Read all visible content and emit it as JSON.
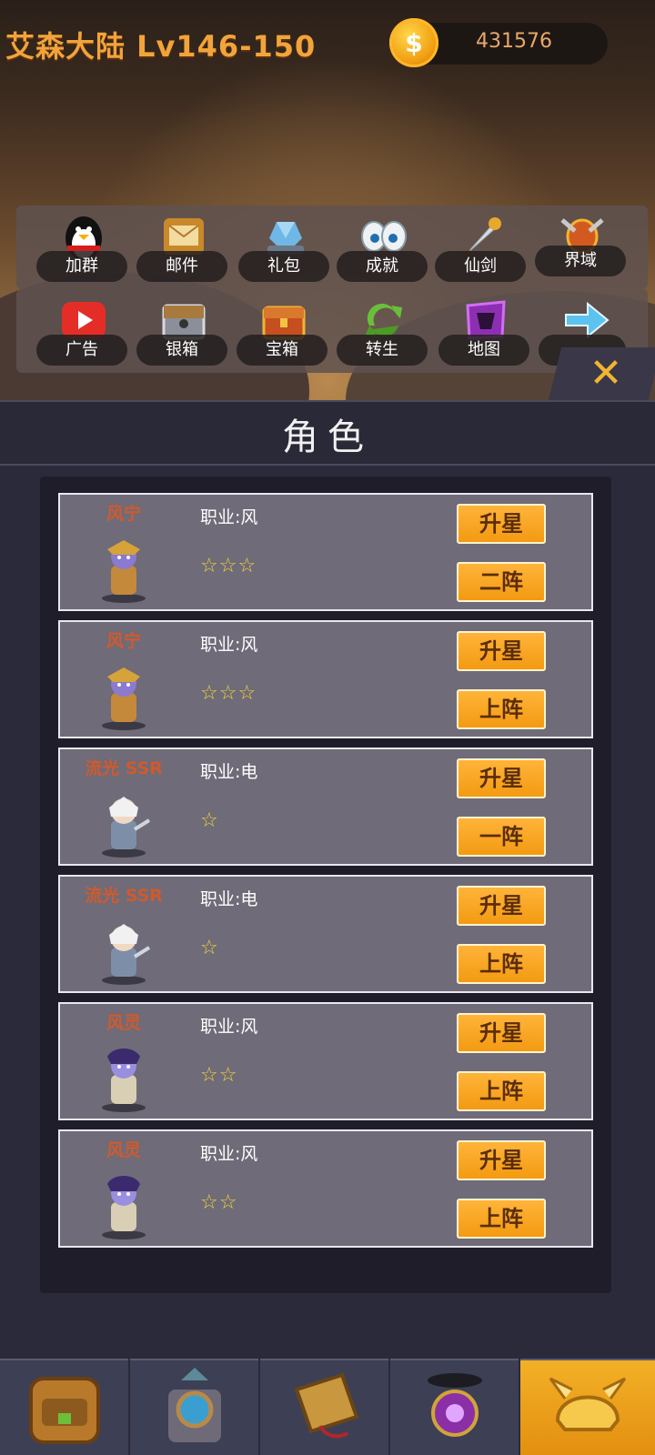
{
  "header": {
    "title": "艾森大陆 Lv146-150",
    "coin_symbol": "$",
    "coins": "431576"
  },
  "menu_row1": [
    {
      "label": "加群",
      "icon": "penguin-icon"
    },
    {
      "label": "邮件",
      "icon": "mail-icon"
    },
    {
      "label": "礼包",
      "icon": "crystal-icon"
    },
    {
      "label": "成就",
      "icon": "eyes-icon"
    },
    {
      "label": "仙剑",
      "icon": "sword-icon"
    },
    {
      "label": "界域",
      "icon": "shield-icon"
    }
  ],
  "menu_row2": [
    {
      "label": "广告",
      "icon": "video-play-icon"
    },
    {
      "label": "银箱",
      "icon": "silver-chest-icon"
    },
    {
      "label": "宝箱",
      "icon": "treasure-chest-icon"
    },
    {
      "label": "转生",
      "icon": "recycle-arrows-icon"
    },
    {
      "label": "地图",
      "icon": "map-icon"
    },
    {
      "label": "",
      "icon": "arrow-right-icon"
    }
  ],
  "close_symbol": "✕",
  "panel": {
    "title": "角色",
    "upgrade_label": "升星",
    "characters": [
      {
        "name": "风宁",
        "job": "职业:风",
        "stars": "☆☆☆",
        "action": "二阵"
      },
      {
        "name": "风宁",
        "job": "职业:风",
        "stars": "☆☆☆",
        "action": "上阵"
      },
      {
        "name": "流光 SSR",
        "job": "职业:电",
        "stars": "☆",
        "action": "一阵"
      },
      {
        "name": "流光 SSR",
        "job": "职业:电",
        "stars": "☆",
        "action": "上阵"
      },
      {
        "name": "风灵",
        "job": "职业:风",
        "stars": "☆☆",
        "action": "上阵"
      },
      {
        "name": "风灵",
        "job": "职业:风",
        "stars": "☆☆",
        "action": "上阵"
      }
    ]
  },
  "tabs": [
    {
      "icon": "backpack-icon",
      "active": false
    },
    {
      "icon": "portal-icon",
      "active": false
    },
    {
      "icon": "scroll-icon",
      "active": false
    },
    {
      "icon": "magic-orb-icon",
      "active": false
    },
    {
      "icon": "helmet-icon",
      "active": true
    }
  ]
}
